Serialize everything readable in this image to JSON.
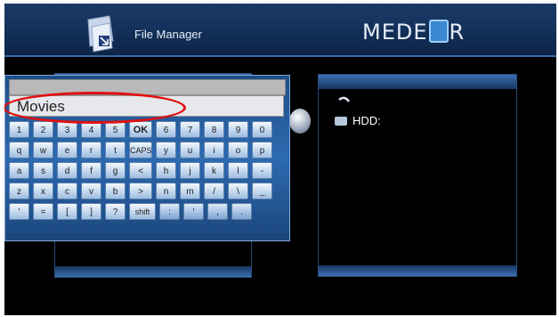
{
  "header": {
    "title": "File Manager",
    "brand_left": "MEDE",
    "brand_right": "R"
  },
  "right_panel": {
    "items": [
      {
        "label": "HDD:"
      }
    ]
  },
  "keyboard": {
    "input_value": "Movies",
    "rows": [
      [
        "1",
        "2",
        "3",
        "4",
        "5",
        "OK",
        "6",
        "7",
        "8",
        "9",
        "0"
      ],
      [
        "q",
        "w",
        "e",
        "r",
        "t",
        "CAPS",
        "y",
        "u",
        "i",
        "o",
        "p"
      ],
      [
        "a",
        "s",
        "d",
        "f",
        "g",
        "<",
        "h",
        "j",
        "k",
        "l",
        "-"
      ],
      [
        "z",
        "x",
        "c",
        "v",
        "b",
        ">",
        "n",
        "m",
        "/",
        "\\",
        "_"
      ],
      [
        "'",
        "=",
        "[",
        "]",
        "?",
        "shift",
        ":",
        "'",
        ",",
        "."
      ]
    ]
  },
  "colors": {
    "header_bg": "#14335e",
    "keyboard_bg": "#2d6ab0",
    "highlight": "#e01010"
  }
}
